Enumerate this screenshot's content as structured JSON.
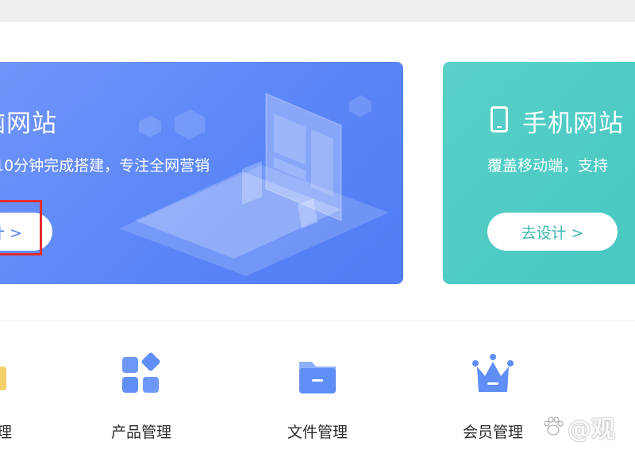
{
  "cards": {
    "pc": {
      "title": "脑网站",
      "desc": "，10分钟完成搭建，专注全网营销",
      "button": "计 >"
    },
    "mobile": {
      "title": "手机网站",
      "desc": "覆盖移动端，支持",
      "button": "去设计 >"
    }
  },
  "quick_nav": {
    "edge_label": "理",
    "items": [
      {
        "label": "产品管理",
        "icon": "product-grid-icon"
      },
      {
        "label": "文件管理",
        "icon": "folder-icon"
      },
      {
        "label": "会员管理",
        "icon": "crown-icon"
      }
    ]
  },
  "watermark": "@观",
  "colors": {
    "pc_card": "#5b86f7",
    "mobile_card": "#47c6c2",
    "icon_blue": "#5f8ef7",
    "highlight": "#e12d2d"
  }
}
